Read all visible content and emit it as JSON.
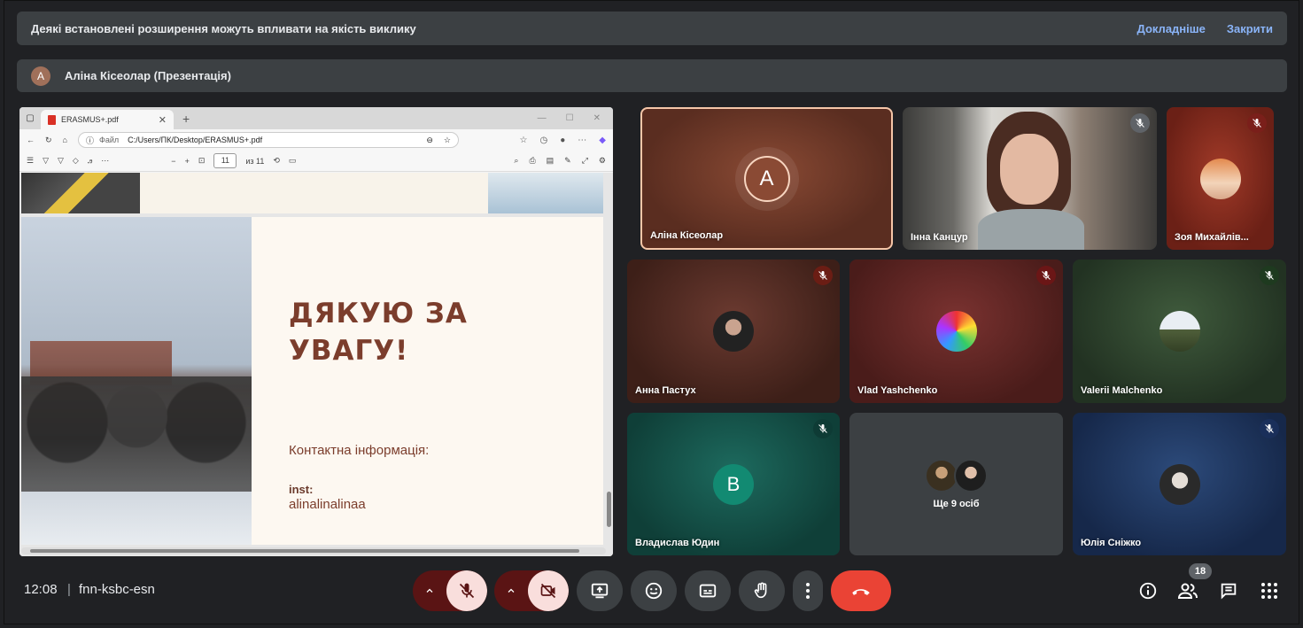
{
  "banner": {
    "message": "Деякі встановлені розширення можуть впливати на якість виклику",
    "more_label": "Докладніше",
    "close_label": "Закрити"
  },
  "presentation": {
    "avatar_letter": "А",
    "title": "Аліна Кісеолар (Презентація)"
  },
  "browser": {
    "tab_title": "ERASMUS+.pdf",
    "address_label": "Файл",
    "address_path": "C:/Users/ПК/Desktop/ERASMUS+.pdf",
    "page_current": "11",
    "page_total": "из 11"
  },
  "slide": {
    "thanks_line1": "ДЯКУЮ ЗА",
    "thanks_line2": "УВАГУ!",
    "contact_label": "Контактна інформація:",
    "inst_label": "inst:",
    "inst_handle": "alinalinalinaa"
  },
  "participants": [
    {
      "name": "Аліна Кісеолар",
      "avatar_letter": "A",
      "speaking": true
    },
    {
      "name": "Інна Канцур"
    },
    {
      "name": "Зоя Михайлів..."
    },
    {
      "name": "Анна Пастух"
    },
    {
      "name": "Vlad Yashchenko"
    },
    {
      "name": "Valerii Malchenko"
    },
    {
      "name": "Владислав Юдин",
      "avatar_letter": "B"
    },
    {
      "name": "Ще 9 осіб"
    },
    {
      "name": "Юлія Сніжко"
    }
  ],
  "bottom_bar": {
    "time": "12:08",
    "separator": "|",
    "meeting_code": "fnn-ksbc-esn",
    "participant_count": "18"
  },
  "colors": {
    "background": "#202124",
    "end_call": "#ea4335",
    "muted_red": "#f9dedc",
    "link": "#8ab4f8",
    "slide_text": "#7b3d2c"
  }
}
